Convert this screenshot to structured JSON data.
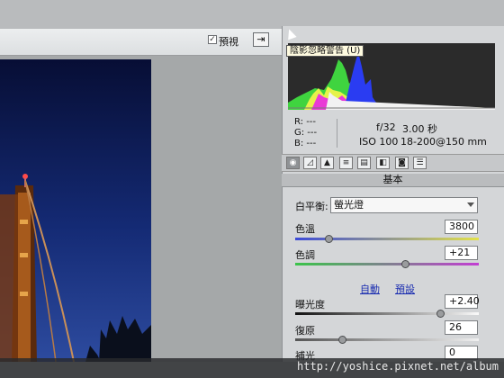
{
  "header": {
    "preview_check": "✓",
    "preview_label": "預視",
    "fullscreen_icon": "⇥"
  },
  "histogram": {
    "tooltip": "陰影忽略警告 (U)"
  },
  "readout": {
    "r": "R:  ---",
    "g": "G:  ---",
    "b": "B:  ---",
    "aperture": "f/32",
    "shutter": "3.00 秒",
    "iso": "ISO 100",
    "lens": "18-200@150 mm"
  },
  "toolbar": {
    "icons": [
      "aperture-icon",
      "curve-icon",
      "mountain-icon",
      "lines-icon",
      "split-icon",
      "lens-icon",
      "camera-icon",
      "preset-icon"
    ],
    "glyphs": [
      "◉",
      "◿",
      "▲",
      "≡",
      "▤",
      "◧",
      "◙",
      "☰"
    ],
    "active_index": 0
  },
  "section": {
    "title": "基本"
  },
  "white_balance": {
    "label": "白平衡:",
    "value": "螢光燈"
  },
  "sliders": [
    {
      "label": "色溫",
      "value": "3800",
      "level": 0.19
    },
    {
      "label": "色調",
      "value": "+21",
      "level": 0.605
    }
  ],
  "links": {
    "auto": "自動",
    "default": "預設"
  },
  "tone_sliders": [
    {
      "label": "曝光度",
      "value": "+2.40",
      "level": 0.8
    },
    {
      "label": "復原",
      "value": "26",
      "level": 0.26
    },
    {
      "label": "補光",
      "value": "0",
      "level": 0
    }
  ],
  "colors": {
    "accent": "#1a2db0",
    "panel": "#d4d6d8"
  },
  "watermark": "http://yoshice.pixnet.net/album"
}
